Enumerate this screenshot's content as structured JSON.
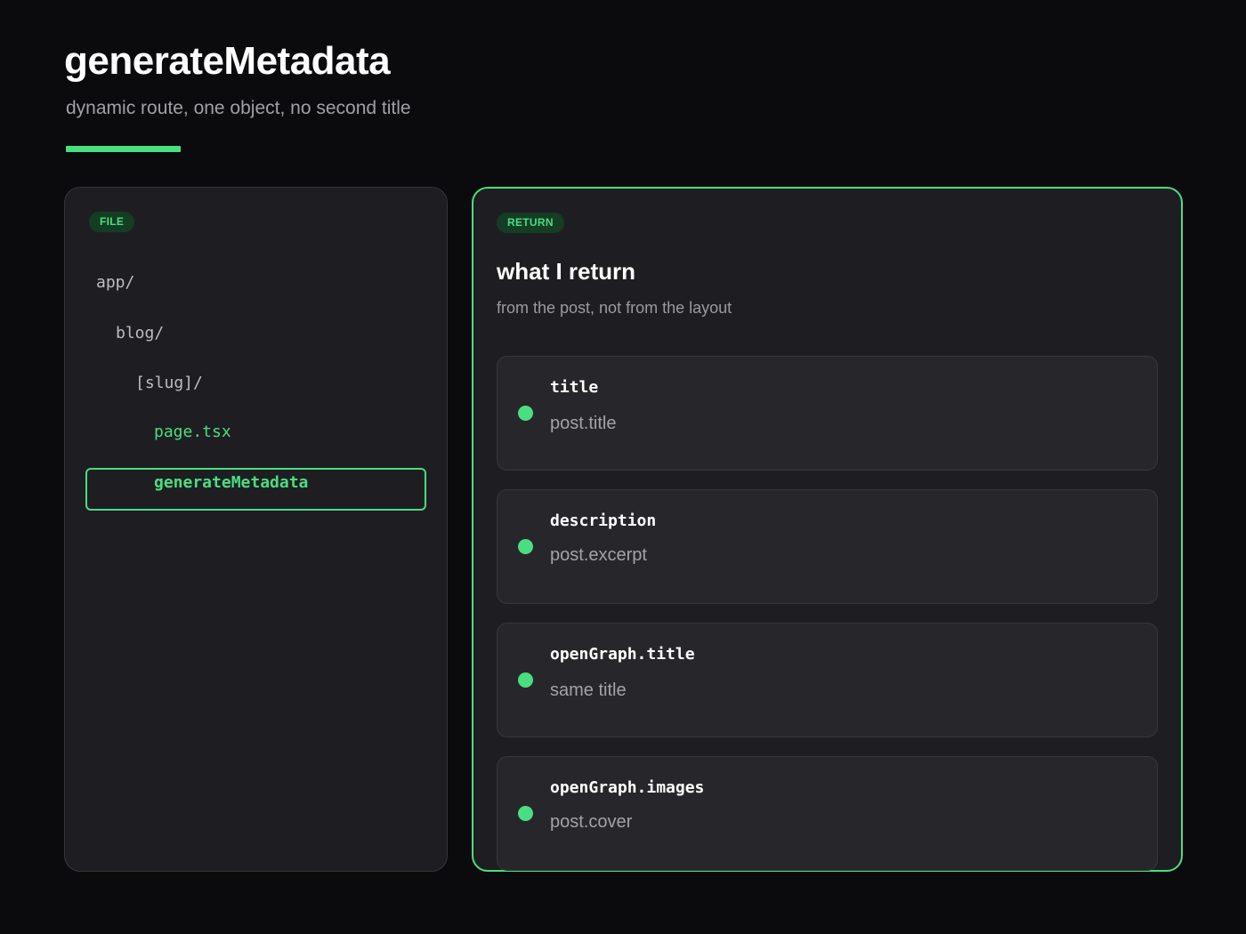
{
  "header": {
    "title": "generateMetadata",
    "subtitle": "dynamic route, one object, no second title"
  },
  "file_panel": {
    "badge": "FILE",
    "tree": [
      {
        "label": "app/",
        "highlighted": false
      },
      {
        "label": "blog/",
        "highlighted": false
      },
      {
        "label": "[slug]/",
        "highlighted": false
      },
      {
        "label": "page.tsx",
        "highlighted": true
      }
    ],
    "selected": "generateMetadata"
  },
  "return_panel": {
    "badge": "RETURN",
    "title": "what I return",
    "subtitle": "from the post, not from the layout",
    "fields": [
      {
        "key": "title",
        "value": "post.title"
      },
      {
        "key": "description",
        "value": "post.excerpt"
      },
      {
        "key": "openGraph.title",
        "value": "same title"
      },
      {
        "key": "openGraph.images",
        "value": "post.cover"
      }
    ]
  },
  "colors": {
    "accent": "#4ade80",
    "background": "#0b0b0d",
    "panel": "#1e1e22"
  }
}
